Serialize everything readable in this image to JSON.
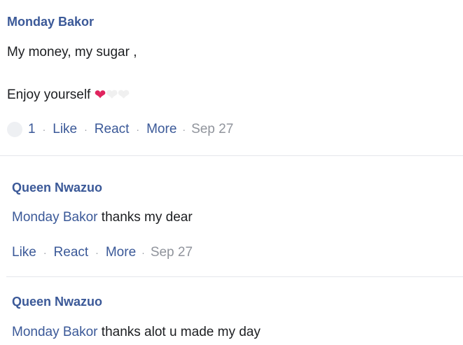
{
  "comments": [
    {
      "author": "Monday Bakor",
      "lines": [
        "My money, my sugar ,",
        "Enjoy yourself"
      ],
      "reaction_count": "1",
      "like_label": "Like",
      "react_label": "React",
      "more_label": "More",
      "time": "Sep 27"
    },
    {
      "author": "Queen Nwazuo",
      "mention": "Monday Bakor",
      "text": " thanks my dear",
      "like_label": "Like",
      "react_label": "React",
      "more_label": "More",
      "time": "Sep 27"
    },
    {
      "author": "Queen Nwazuo",
      "mention": "Monday Bakor",
      "text": " thanks alot u made my day"
    }
  ],
  "colors": {
    "name_blue": "#3b5998",
    "meta_gray": "#90949c",
    "heart_red": "#e0245e"
  },
  "icons": [
    "red-heart-emoji-icon",
    "white-heart-emoji-icon",
    "reaction-bubble-icon"
  ]
}
